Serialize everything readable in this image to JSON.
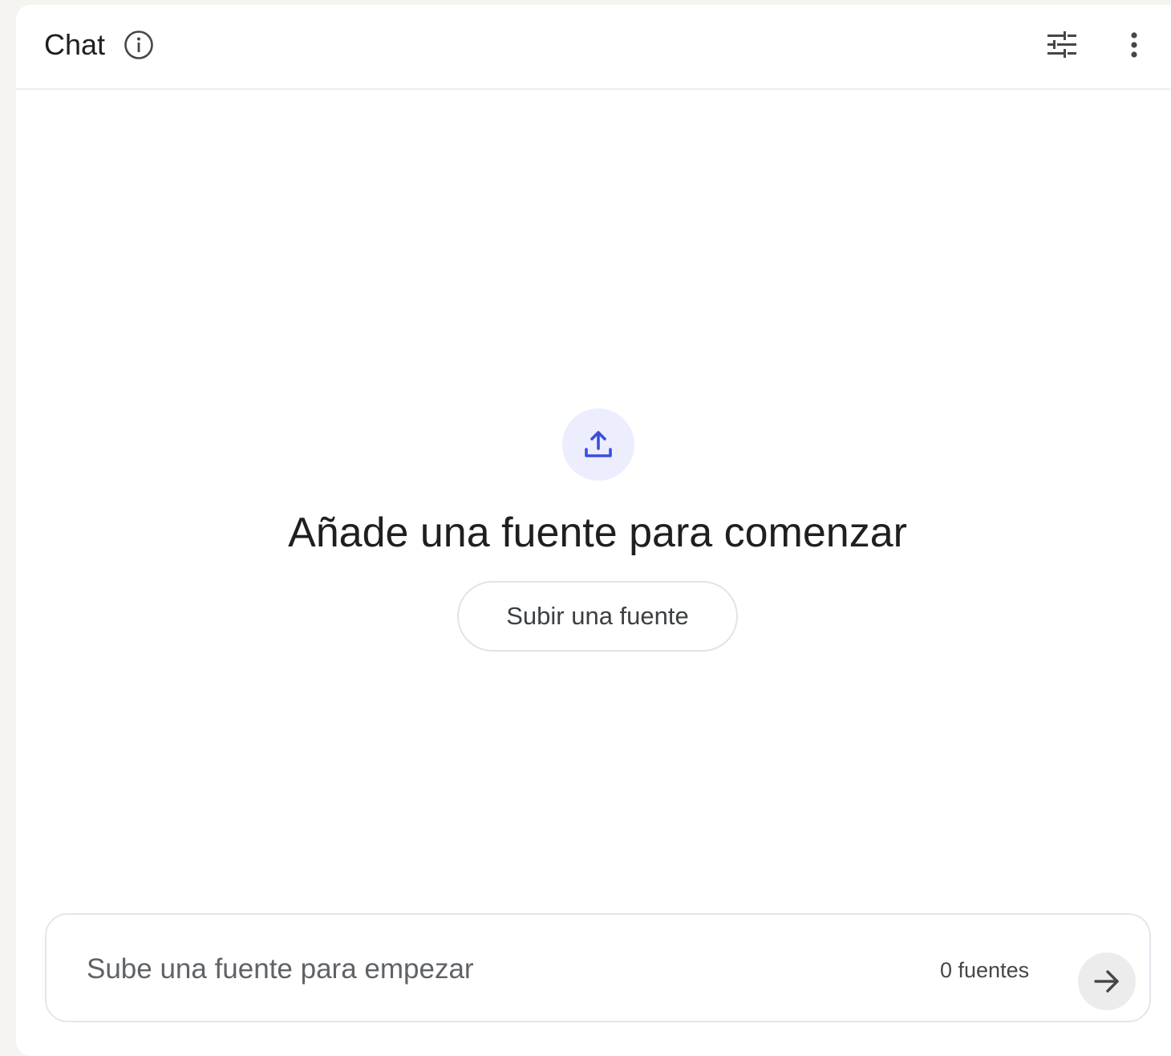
{
  "header": {
    "title": "Chat",
    "info_icon": "info-icon",
    "settings_icon": "tune-icon",
    "menu_icon": "more-vert-icon"
  },
  "empty_state": {
    "icon": "upload-icon",
    "title": "Añade una fuente para comenzar",
    "button_label": "Subir una fuente"
  },
  "composer": {
    "placeholder": "Sube una fuente para empezar",
    "value": "",
    "source_count": "0 fuentes",
    "send_icon": "arrow-right-icon"
  },
  "colors": {
    "accent": "#3b4ee0",
    "upload_circle_bg": "#ecedfd",
    "send_button_bg": "#ececec",
    "text_primary": "#1f1f1f"
  }
}
